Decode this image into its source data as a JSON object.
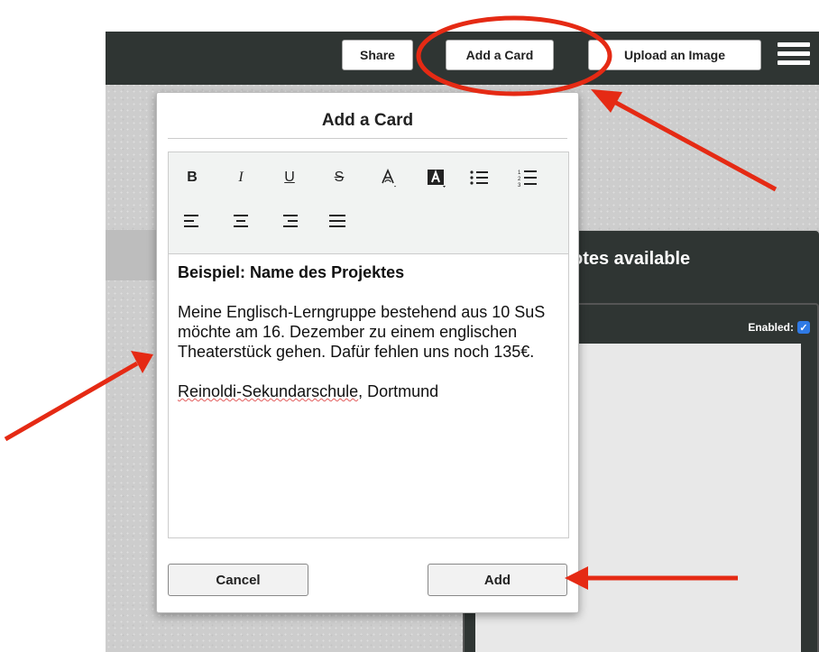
{
  "topbar": {
    "share_label": "Share",
    "add_card_label": "Add a Card",
    "upload_image_label": "Upload an Image",
    "menu_icon": "hamburger-icon"
  },
  "board": {
    "notes_title": "otes available",
    "enabled_label": "Enabled:",
    "enabled_checked": true
  },
  "modal": {
    "title": "Add a Card",
    "toolbar": {
      "bold": "B",
      "italic": "I",
      "underline": "U",
      "strikethrough": "S",
      "font_color_icon": "font-color-icon",
      "highlight_icon": "highlight-color-icon",
      "bullet_list_icon": "bullet-list-icon",
      "numbered_list_icon": "numbered-list-icon",
      "align_left_icon": "align-left-icon",
      "align_center_icon": "align-center-icon",
      "align_right_icon": "align-right-icon",
      "align_justify_icon": "align-justify-icon"
    },
    "content": {
      "heading": "Beispiel: Name des Projektes",
      "body": "Meine Englisch-Lerngruppe bestehend aus 10 SuS möchte am 16. Dezember zu einem englischen Theaterstück gehen. Dafür fehlen uns noch 135€.",
      "signature_misspelled": "Reinoldi-Sekundarschule",
      "signature_rest": ", Dortmund"
    },
    "cancel_label": "Cancel",
    "add_label": "Add"
  },
  "colors": {
    "annotation_red": "#e52a14",
    "topbar_dark": "#2f3533",
    "checkbox_blue": "#2f7ae5"
  }
}
